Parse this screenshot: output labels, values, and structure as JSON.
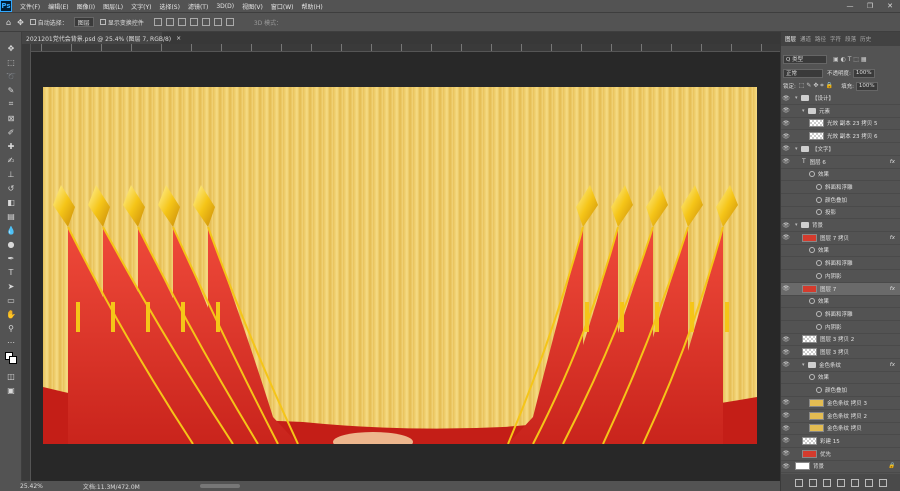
{
  "menu": {
    "logo": "Ps",
    "items": [
      "文件(F)",
      "编辑(E)",
      "图像(I)",
      "图层(L)",
      "文字(Y)",
      "选择(S)",
      "滤镜(T)",
      "3D(D)",
      "视图(V)",
      "窗口(W)",
      "帮助(H)"
    ],
    "window_controls": [
      "—",
      "❐",
      "✕"
    ]
  },
  "options": {
    "home_icon": "home-icon",
    "move_icon": "move-icon",
    "auto_select_label": "自动选择：",
    "auto_select_value": "图层",
    "show_transform_label": "显示变换控件",
    "mode_label": "3D 模式："
  },
  "document": {
    "tab_title": "2021201党代会背景.psd @ 25.4% (图层 7, RGB/8)",
    "tab_close": "×"
  },
  "status": {
    "zoom": "25.42%",
    "doc_info": "文档:11.3M/472.0M"
  },
  "panel": {
    "tabs": [
      "图层",
      "通道",
      "路径",
      "字符",
      "段落",
      "历史"
    ],
    "filter_kind": "Q 类型",
    "blend_mode": "正常",
    "opacity_label": "不透明度:",
    "opacity_value": "100%",
    "lock_label": "锁定:",
    "fill_label": "填充:",
    "fill_value": "100%",
    "layers": [
      {
        "name": "【设计】",
        "kind": "folder",
        "indent": 0
      },
      {
        "name": "元素",
        "kind": "folder",
        "indent": 1
      },
      {
        "name": "光效 副本 23 拷贝 5",
        "kind": "layer",
        "indent": 2,
        "thumb": "checker"
      },
      {
        "name": "光效 副本 23 拷贝 6",
        "kind": "layer",
        "indent": 2,
        "thumb": "checker"
      },
      {
        "name": "【文字】",
        "kind": "folder",
        "indent": 0
      },
      {
        "name": "图层 6",
        "kind": "text",
        "indent": 1,
        "fx": true
      },
      {
        "name": "效果",
        "kind": "effect",
        "indent": 2
      },
      {
        "name": "斜面和浮雕",
        "kind": "effect",
        "indent": 3
      },
      {
        "name": "颜色叠加",
        "kind": "effect",
        "indent": 3
      },
      {
        "name": "投影",
        "kind": "effect",
        "indent": 3
      },
      {
        "name": "背景",
        "kind": "folder",
        "indent": 0
      },
      {
        "name": "图层 7 拷贝",
        "kind": "layer",
        "indent": 1,
        "thumb": "red",
        "fx": true
      },
      {
        "name": "效果",
        "kind": "effect",
        "indent": 2
      },
      {
        "name": "斜面和浮雕",
        "kind": "effect",
        "indent": 3
      },
      {
        "name": "内阴影",
        "kind": "effect",
        "indent": 3
      },
      {
        "name": "图层 7",
        "kind": "layer",
        "indent": 1,
        "thumb": "red",
        "fx": true,
        "selected": true
      },
      {
        "name": "效果",
        "kind": "effect",
        "indent": 2
      },
      {
        "name": "斜面和浮雕",
        "kind": "effect",
        "indent": 3
      },
      {
        "name": "内阴影",
        "kind": "effect",
        "indent": 3
      },
      {
        "name": "图层 3 拷贝 2",
        "kind": "layer",
        "indent": 1,
        "thumb": "checker"
      },
      {
        "name": "图层 3 拷贝",
        "kind": "layer",
        "indent": 1,
        "thumb": "checker"
      },
      {
        "name": "金色条纹",
        "kind": "folder",
        "indent": 1,
        "fx": true
      },
      {
        "name": "效果",
        "kind": "effect",
        "indent": 2
      },
      {
        "name": "颜色叠加",
        "kind": "effect",
        "indent": 3
      },
      {
        "name": "金色条纹 拷贝 3",
        "kind": "layer",
        "indent": 2,
        "thumb": "gold"
      },
      {
        "name": "金色条纹 拷贝 2",
        "kind": "layer",
        "indent": 2,
        "thumb": "gold"
      },
      {
        "name": "金色条纹 拷贝",
        "kind": "layer",
        "indent": 2,
        "thumb": "gold"
      },
      {
        "name": "彩建 15",
        "kind": "layer",
        "indent": 1,
        "thumb": "checker"
      },
      {
        "name": "优先",
        "kind": "layer",
        "indent": 1,
        "thumb": "red"
      },
      {
        "name": "背景",
        "kind": "layer",
        "indent": 0,
        "thumb": "white",
        "locked": true
      }
    ]
  },
  "colors": {
    "flag_red": "#e8392f",
    "flag_dark": "#b91f1a",
    "gold": "#f5c518",
    "gold_dark": "#d49b0c"
  }
}
